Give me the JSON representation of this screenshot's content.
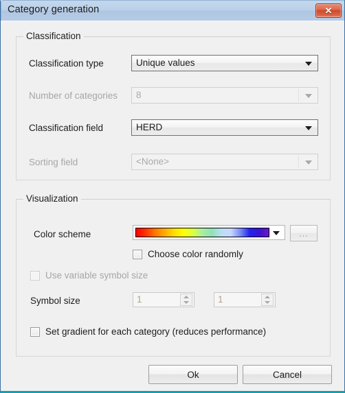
{
  "window": {
    "title": "Category generation",
    "close_label": "✕"
  },
  "classification": {
    "group_title": "Classification",
    "rows": [
      {
        "label": "Classification type",
        "value": "Unique values",
        "enabled": true
      },
      {
        "label": "Number of categories",
        "value": "8",
        "enabled": false
      },
      {
        "label": "Classification field",
        "value": "HERD",
        "enabled": true
      },
      {
        "label": "Sorting field",
        "value": "<None>",
        "enabled": false
      }
    ]
  },
  "visualization": {
    "group_title": "Visualization",
    "color_scheme_label": "Color scheme",
    "color_scheme_gradient": [
      "#ff0000",
      "#ff3300",
      "#ff7700",
      "#ffaa00",
      "#ffdd00",
      "#ffff00",
      "#ddff44",
      "#a8eea0",
      "#8fe0b8",
      "#b9dff0",
      "#c8d8ff",
      "#7a8cf5",
      "#2222ee",
      "#3a14d0",
      "#6a18c8"
    ],
    "ellipsis_button": "...",
    "choose_color_randomly": {
      "label": "Choose color randomly",
      "checked": false,
      "enabled": true
    },
    "use_variable_symbol_size": {
      "label": "Use variable symbol size",
      "checked": false,
      "enabled": false
    },
    "symbol_size_label": "Symbol size",
    "symbol_size_min": {
      "value": "1",
      "enabled": false
    },
    "symbol_size_max": {
      "value": "1",
      "enabled": false
    },
    "set_gradient": {
      "label": "Set gradient for each category (reduces performance)",
      "checked": false,
      "enabled": true
    }
  },
  "footer": {
    "ok_label": "Ok",
    "cancel_label": "Cancel"
  }
}
